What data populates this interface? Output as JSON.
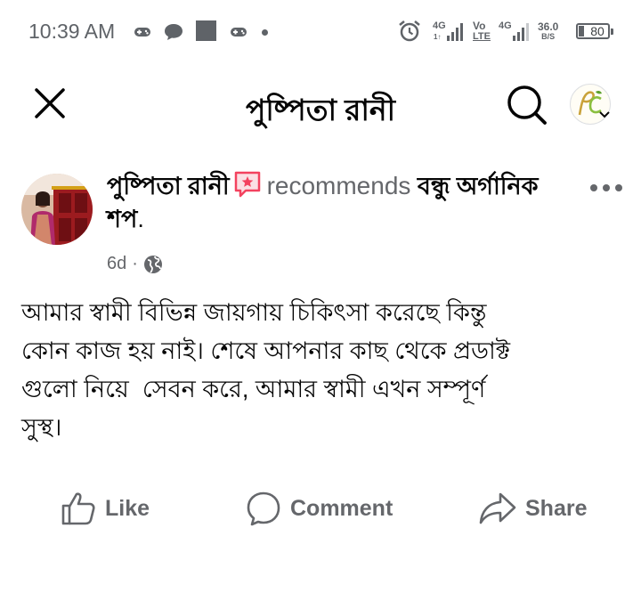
{
  "status_bar": {
    "time": "10:39 AM",
    "network1": "4G",
    "network1_sub": "1↑",
    "volte_top": "Vo",
    "volte_bottom": "LTE",
    "network2": "4G",
    "speed_value": "36.0",
    "speed_unit": "B/S",
    "battery": "80",
    "icons": [
      "game-controller-icon",
      "chat-bubble-icon",
      "gallery-square-icon",
      "game-controller-icon",
      "dot-icon",
      "alarm-icon",
      "signal-icon",
      "battery-icon"
    ]
  },
  "header": {
    "title": "পুষ্পিতা রানী",
    "close_icon": "close-icon",
    "search_icon": "search-icon",
    "profile_icon": "profile-logo-icon"
  },
  "post": {
    "author": "পুষ্পিতা রানী",
    "recommends": "recommends",
    "page_name_line1": "বন্ধু",
    "page_name_line2": "অর্গানিক শপ",
    "punctuation": ".",
    "time": "6d",
    "meta_separator": "·",
    "privacy_icon": "globe-icon",
    "body_lines": [
      "আমার স্বামী বিভিন্ন জায়গায় চিকিৎসা করেছে কিন্তু",
      "কোন কাজ হয় নাই। শেষে আপনার কাছ থেকে প্রডাক্ট",
      "গুলো নিয়ে  সেবন করে, আমার স্বামী এখন সম্পূর্ণ",
      "সুস্থ।"
    ]
  },
  "actions": {
    "like": "Like",
    "comment": "Comment",
    "share": "Share"
  },
  "colors": {
    "secondary_text": "#65676b",
    "primary_text": "#050505",
    "recommend_badge": "#f3425f"
  }
}
